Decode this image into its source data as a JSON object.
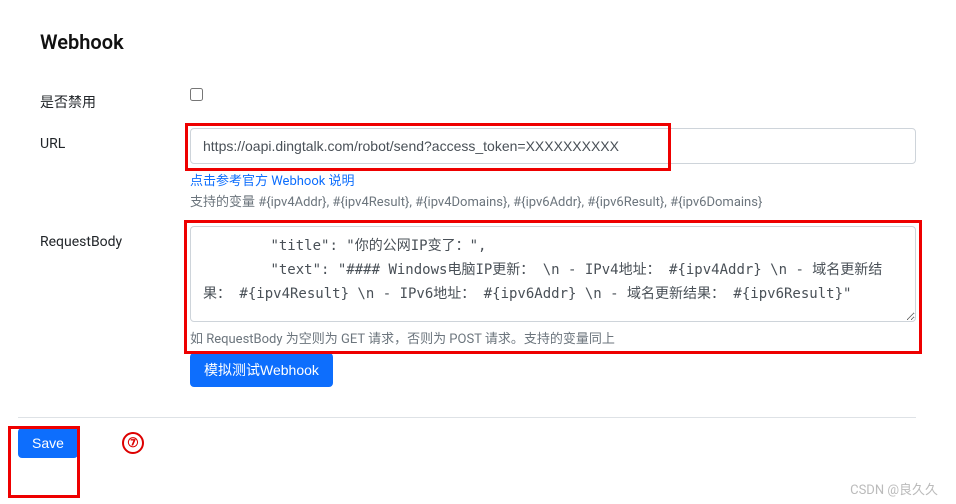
{
  "panel": {
    "title": "Webhook"
  },
  "form": {
    "disable_label": "是否禁用",
    "url_label": "URL",
    "url_value": "https://oapi.dingtalk.com/robot/send?access_token=XXXXXXXXXX",
    "url_help_link": "点击参考官方 Webhook 说明",
    "url_help_vars": "支持的变量 #{ipv4Addr}, #{ipv4Result}, #{ipv4Domains}, #{ipv6Addr}, #{ipv6Result}, #{ipv6Domains}",
    "body_label": "RequestBody",
    "body_value": "        \"title\": \"你的公网IP变了：\",\n        \"text\": \"#### Windows电脑IP更新： \\n - IPv4地址： #{ipv4Addr} \\n - 域名更新结果： #{ipv4Result} \\n - IPv6地址： #{ipv6Addr} \\n - 域名更新结果： #{ipv6Result}\"",
    "body_help": "如 RequestBody 为空则为 GET 请求，否则为 POST 请求。支持的变量同上",
    "test_button": "模拟测试Webhook"
  },
  "footer": {
    "save_button": "Save",
    "step_number": "⑦"
  },
  "watermark": "CSDN @良久久"
}
